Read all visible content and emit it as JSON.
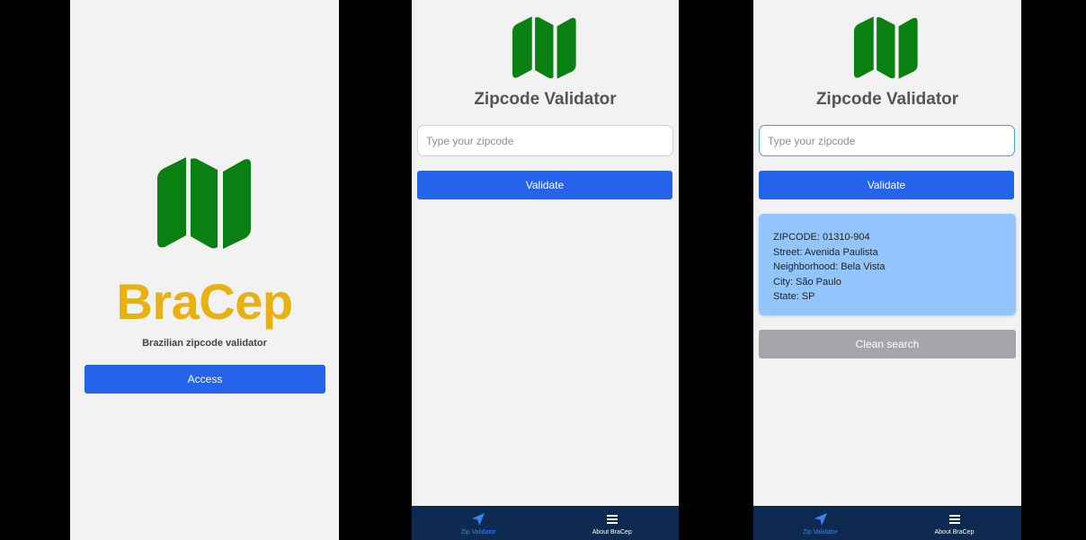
{
  "colors": {
    "brand_green": "#0a8012",
    "brand_yellow": "#e8b112",
    "primary_button": "#2563eb",
    "result_card": "#93c5fd",
    "clean_button": "#a3a5a9",
    "tab_bar": "#0e2a50",
    "tab_active": "#3b82f6"
  },
  "welcome": {
    "logo_icon": "map-icon",
    "brand_name": "BraCep",
    "tagline": "Brazilian zipcode validator",
    "access_label": "Access"
  },
  "validator": {
    "logo_icon": "map-icon",
    "title": "Zipcode Validator",
    "input_placeholder": "Type your zipcode",
    "validate_label": "Validate"
  },
  "result": {
    "lines": [
      "ZIPCODE: 01310-904",
      "Street: Avenida Paulista",
      "Neighborhood: Bela Vista",
      "City: São Paulo",
      "State: SP"
    ],
    "clean_label": "Clean search"
  },
  "tabs": [
    {
      "label": "Zip Validator",
      "icon": "navigation-arrow-icon",
      "active": true
    },
    {
      "label": "About BraCep",
      "icon": "menu-icon",
      "active": false
    }
  ]
}
